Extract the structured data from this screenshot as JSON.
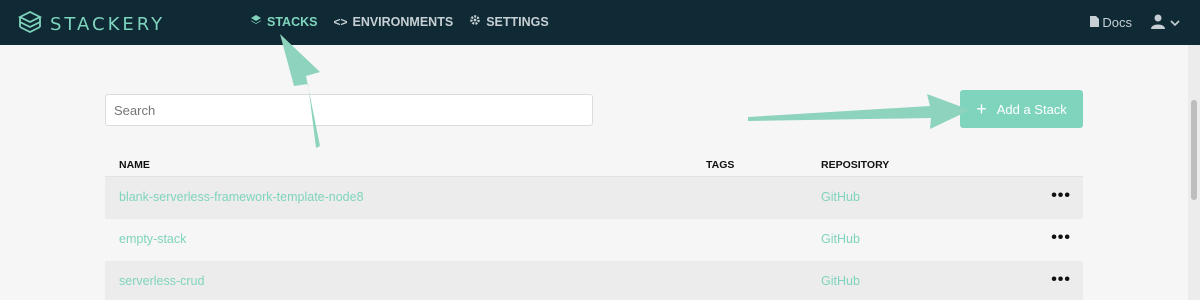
{
  "brand": {
    "name": "STACKERY",
    "accent": "#7fd4bd",
    "header_bg": "#0f2a35"
  },
  "nav": [
    {
      "label": "STACKS",
      "icon": "layers-icon",
      "active": true
    },
    {
      "label": "ENVIRONMENTS",
      "icon": "code-icon",
      "active": false
    },
    {
      "label": "SETTINGS",
      "icon": "gear-icon",
      "active": false
    }
  ],
  "header_right": {
    "docs_label": "Docs"
  },
  "search": {
    "placeholder": "Search",
    "value": ""
  },
  "add_button": {
    "label": "Add a Stack"
  },
  "table": {
    "columns": [
      "NAME",
      "TAGS",
      "REPOSITORY"
    ],
    "rows": [
      {
        "name": "blank-serverless-framework-template-node8",
        "tags": "",
        "repository": "GitHub"
      },
      {
        "name": "empty-stack",
        "tags": "",
        "repository": "GitHub"
      },
      {
        "name": "serverless-crud",
        "tags": "",
        "repository": "GitHub"
      }
    ],
    "row_menu": "•••"
  }
}
